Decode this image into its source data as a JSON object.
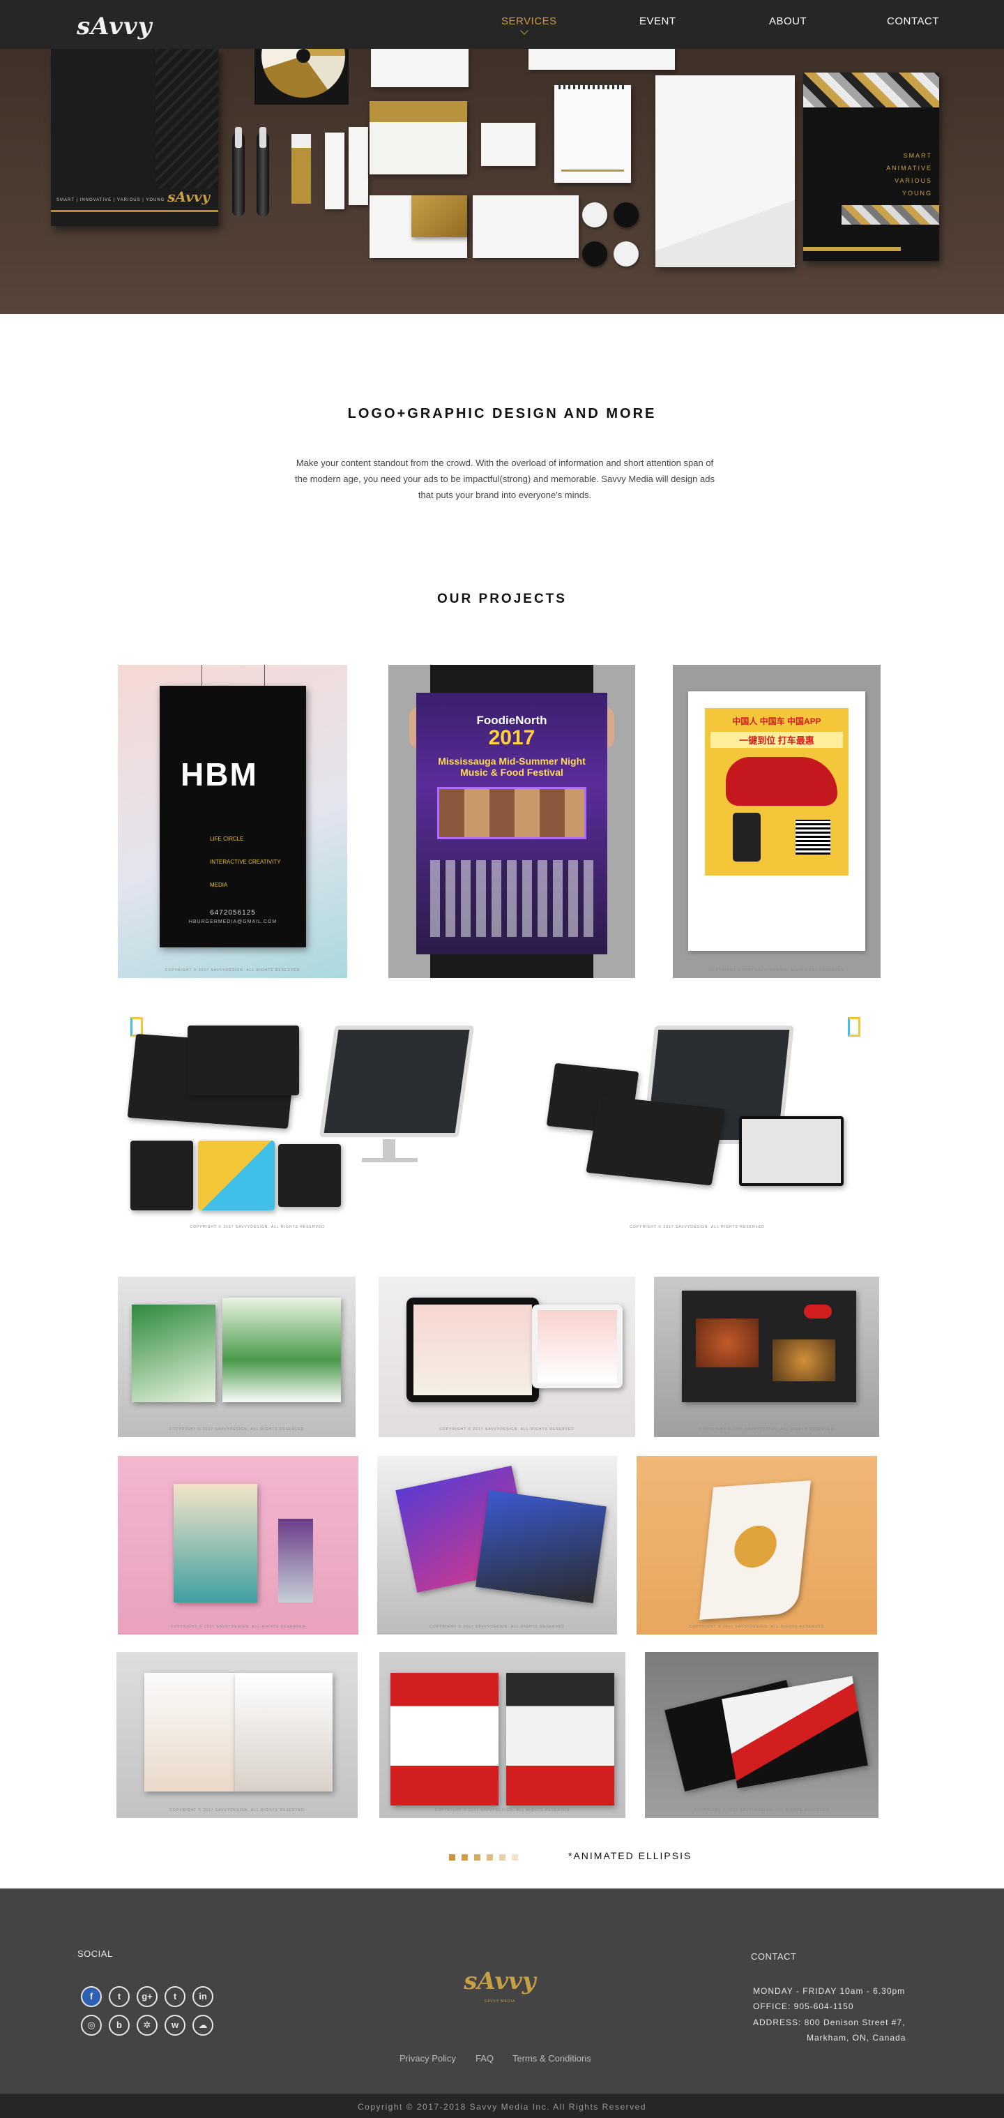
{
  "header": {
    "logo_text": "sAvvy",
    "nav": [
      {
        "label": "SERVICES",
        "active": true
      },
      {
        "label": "EVENT",
        "active": false
      },
      {
        "label": "ABOUT",
        "active": false
      },
      {
        "label": "CONTACT",
        "active": false
      }
    ]
  },
  "hero": {
    "folder_tagline": "SMART | INNOVATIVE | VARIOUS | YOUNG",
    "folder_words": [
      "SMART",
      "ANIMATIVE",
      "VARIOUS",
      "YOUNG"
    ],
    "mini_logo": "sAvvy"
  },
  "intro": {
    "title": "LOGO+GRAPHIC DESIGN AND MORE",
    "text": "Make your content standout from the crowd. With the overload of information and short attention span of the modern age, you need your ads to be impactful(strong) and memorable. Savvy Media will design ads that puts your brand into everyone's minds."
  },
  "projects": {
    "title": "OUR PROJECTS",
    "copyright_note": "COPYRIGHT © 2017 SAVVYDESIGN. ALL RIGHTS RESERVED",
    "poster1": {
      "brand": "HBM",
      "items": [
        "LIFE CIRCLE",
        "INTERACTIVE CREATIVITY",
        "MEDIA"
      ],
      "phone": "6472056125",
      "email": "HBURGERMEDIA@GMAIL.COM"
    },
    "poster2": {
      "line1": "FoodieNorth",
      "line2": "2017",
      "line3": "Mississauga Mid-Summer Night",
      "line4": "Music & Food Festival"
    },
    "poster3": {
      "line1": "中国人 中国车 中国APP",
      "line2": "一键到位 打车最惠"
    }
  },
  "ellipsis": {
    "label": "*ANIMATED ELLIPSIS",
    "colors": [
      "#c8953c",
      "#cf9f4c",
      "#d6ab62",
      "#dfbd83",
      "#e8d0a8",
      "#f1e4cf"
    ]
  },
  "footer": {
    "social_label": "SOCIAL",
    "contact_label": "CONTACT",
    "social_row1": [
      {
        "icon": "facebook-icon",
        "glyph": "f"
      },
      {
        "icon": "twitter-icon",
        "glyph": "t"
      },
      {
        "icon": "google-plus-icon",
        "glyph": "g+"
      },
      {
        "icon": "tumblr-icon",
        "glyph": "t"
      },
      {
        "icon": "linkedin-icon",
        "glyph": "in"
      }
    ],
    "social_row2": [
      {
        "icon": "instagram-icon",
        "glyph": "◎"
      },
      {
        "icon": "bilibili-icon",
        "glyph": "b"
      },
      {
        "icon": "wechat-moments-icon",
        "glyph": "✲"
      },
      {
        "icon": "weibo-icon",
        "glyph": "w"
      },
      {
        "icon": "wechat-icon",
        "glyph": "☁"
      }
    ],
    "logo_text": "sAvvy",
    "logo_sub": "SAVVY MEDIA",
    "hours": "MONDAY - FRIDAY 10am - 6.30pm",
    "office": "OFFICE:  905-604-1150",
    "address1": "ADDRESS: 800 Denison Street #7,",
    "address2": "Markham, ON, Canada",
    "links": [
      "Privacy Policy",
      "FAQ",
      "Terms & Conditions"
    ],
    "copyright": "Copyright © 2017-2018  Savvy Media Inc. All Rights Reserved"
  }
}
